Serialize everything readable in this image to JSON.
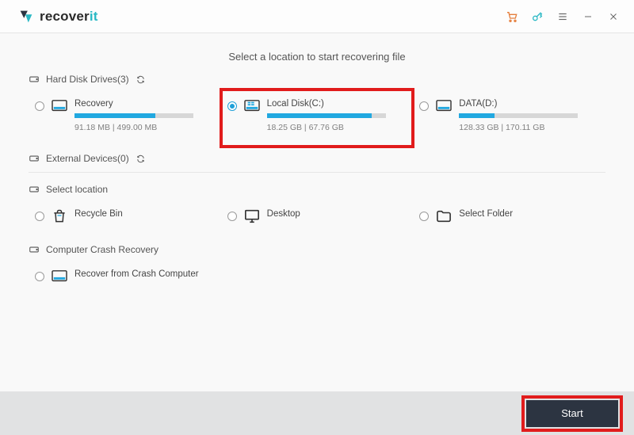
{
  "app": {
    "name_prefix": "recover",
    "name_accent": "it"
  },
  "heading": "Select a location to start recovering file",
  "sections": {
    "drives": {
      "label": "Hard Disk Drives(3)"
    },
    "external": {
      "label": "External Devices(0)"
    },
    "select_location": {
      "label": "Select location"
    },
    "crash": {
      "label": "Computer Crash Recovery"
    }
  },
  "drives": [
    {
      "name": "Recovery",
      "usage": "91.18  MB | 499.00  MB",
      "fill_pct": 68,
      "selected": false
    },
    {
      "name": "Local Disk(C:)",
      "usage": "18.25  GB | 67.76  GB",
      "fill_pct": 88,
      "selected": true
    },
    {
      "name": "DATA(D:)",
      "usage": "128.33  GB | 170.11  GB",
      "fill_pct": 30,
      "selected": false
    }
  ],
  "locations": [
    {
      "name": "Recycle Bin"
    },
    {
      "name": "Desktop"
    },
    {
      "name": "Select Folder"
    }
  ],
  "crash_item": {
    "name": "Recover from Crash Computer"
  },
  "footer": {
    "start": "Start"
  }
}
